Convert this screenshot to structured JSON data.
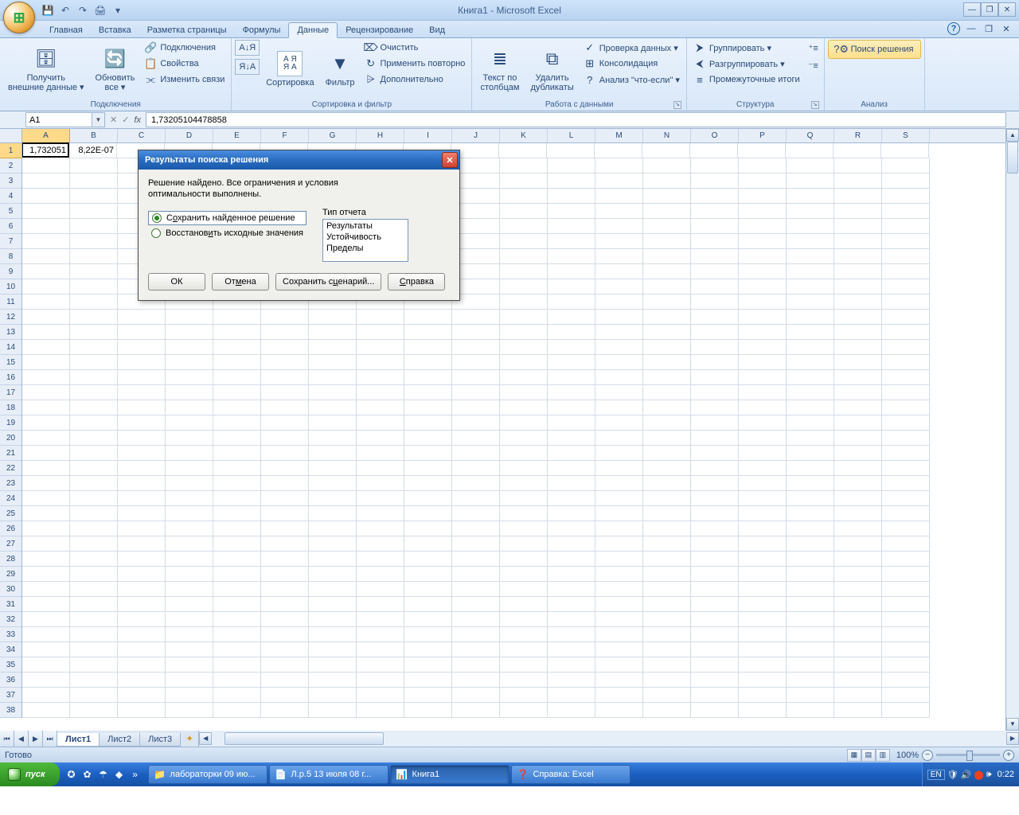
{
  "title": "Книга1 - Microsoft Excel",
  "tabs": {
    "items": [
      "Главная",
      "Вставка",
      "Разметка страницы",
      "Формулы",
      "Данные",
      "Рецензирование",
      "Вид"
    ],
    "active": 4
  },
  "ribbon": {
    "g_conn": {
      "get_ext": "Получить\nвнешние данные ▾",
      "refresh": "Обновить\nвсе ▾",
      "connections": "Подключения",
      "properties": "Свойства",
      "edit_links": "Изменить связи",
      "label": "Подключения"
    },
    "g_sort": {
      "az": "А↓Я",
      "za": "Я↓А",
      "sort": "Сортировка",
      "filter": "Фильтр",
      "clear": "Очистить",
      "reapply": "Применить повторно",
      "advanced": "Дополнительно",
      "label": "Сортировка и фильтр"
    },
    "g_data": {
      "text_cols": "Текст по\nстолбцам",
      "dedup": "Удалить\nдубликаты",
      "validation": "Проверка данных ▾",
      "consolidate": "Консолидация",
      "whatif": "Анализ \"что-если\" ▾",
      "label": "Работа с данными"
    },
    "g_struct": {
      "group": "Группировать ▾",
      "ungroup": "Разгруппировать ▾",
      "subtotal": "Промежуточные итоги",
      "label": "Структура"
    },
    "g_analysis": {
      "solver": "Поиск решения",
      "label": "Анализ"
    }
  },
  "namebox": "A1",
  "formula": "1,73205104478858",
  "columns": [
    "A",
    "B",
    "C",
    "D",
    "E",
    "F",
    "G",
    "H",
    "I",
    "J",
    "K",
    "L",
    "M",
    "N",
    "O",
    "P",
    "Q",
    "R",
    "S"
  ],
  "cells": {
    "A1": "1,732051",
    "B1": "8,22E-07"
  },
  "sheets": {
    "items": [
      "Лист1",
      "Лист2",
      "Лист3"
    ],
    "active": 0
  },
  "status": {
    "ready": "Готово",
    "zoom": "100%"
  },
  "dialog": {
    "title": "Результаты поиска решения",
    "message1": "Решение найдено. Все ограничения и условия",
    "message2": "оптимальности выполнены.",
    "report_label": "Тип отчета",
    "radio_keep_pre": "С",
    "radio_keep_u": "о",
    "radio_keep_post": "хранить найденное решение",
    "radio_restore_pre": "Восстанов",
    "radio_restore_u": "и",
    "radio_restore_post": "ть исходные значения",
    "reports": [
      "Результаты",
      "Устойчивость",
      "Пределы"
    ],
    "btn_ok": "ОК",
    "btn_cancel_pre": "От",
    "btn_cancel_u": "м",
    "btn_cancel_post": "ена",
    "btn_save_pre": "Сохранить с",
    "btn_save_u": "ц",
    "btn_save_post": "енарий...",
    "btn_help_u": "С",
    "btn_help_post": "правка"
  },
  "taskbar": {
    "start": "пуск",
    "items": [
      {
        "label": "лабораторки 09 ию...",
        "icon": "📁"
      },
      {
        "label": "Л.р.5  13 июля 08 г...",
        "icon": "📄"
      },
      {
        "label": "Книга1",
        "icon": "📊",
        "active": true
      },
      {
        "label": "Справка: Excel",
        "icon": "❓"
      }
    ],
    "lang": "EN",
    "clock": "0:22"
  }
}
